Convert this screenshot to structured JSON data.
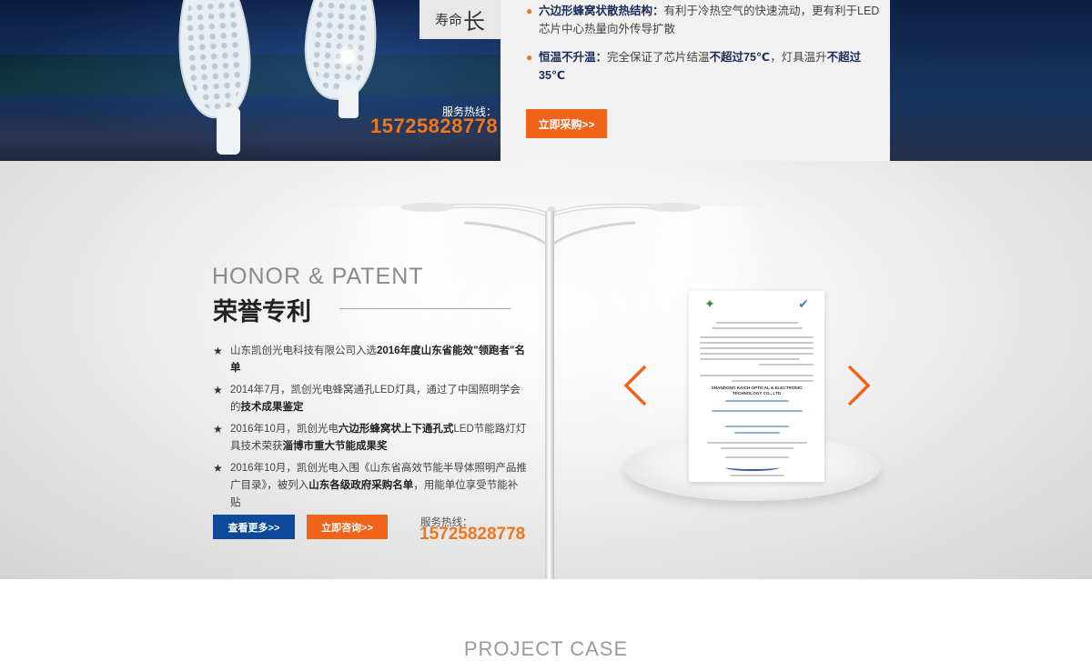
{
  "banner": {
    "life_label": "寿命",
    "life_big": "长",
    "hotline_label": "服务热线：",
    "hotline_number": "15725828778",
    "features": [
      {
        "title": "六边形蜂窝状散热结构：",
        "text": "有利于冷热空气的快速流动，更有利于LED芯片中心热量向外传导扩散"
      },
      {
        "title": "恒温不升温：",
        "text_a": "完全保证了芯片结温",
        "bold_a": "不超过75℃",
        "text_b": "，灯具温升",
        "bold_b": "不超过35℃"
      }
    ],
    "buy_label": "立即采购>>"
  },
  "honor": {
    "title_en": "HONOR & PATENT",
    "title_cn": "荣誉专利",
    "items": [
      {
        "a": "山东凯创光电科技有限公司入选",
        "b": "2016年度山东省能效\"领跑者\"名单",
        "c": ""
      },
      {
        "a": "2014年7月，凯创光电蜂窝通孔LED灯具，通过了中国照明学会的",
        "b": "技术成果鉴定",
        "c": ""
      },
      {
        "a": "2016年10月，凯创光电",
        "b": "六边形蜂窝状上下通孔式",
        "c": "LED节能路灯灯具技术荣获",
        "d": "淄博市重大节能成果奖"
      },
      {
        "a": "2016年10月，凯创光电入围《山东省高效节能半导体照明产品推广目录》，被列入",
        "b": "山东各级政府采购名单",
        "c": "，用能单位享受节能补贴"
      }
    ],
    "more_label": "查看更多>>",
    "consult_label": "立即咨询>>",
    "hotline_label": "服务热线：",
    "hotline_number": "15725828778",
    "certificate_en": "SHANDONG KAICH OPTICAL & ELECTRONIC TECHNOLOGY CO., LTD"
  },
  "project": {
    "title_en": "PROJECT CASE"
  },
  "colors": {
    "accent_orange": "#f0641a",
    "accent_blue": "#0d4b9a",
    "navy_text": "#1a2d5a"
  }
}
